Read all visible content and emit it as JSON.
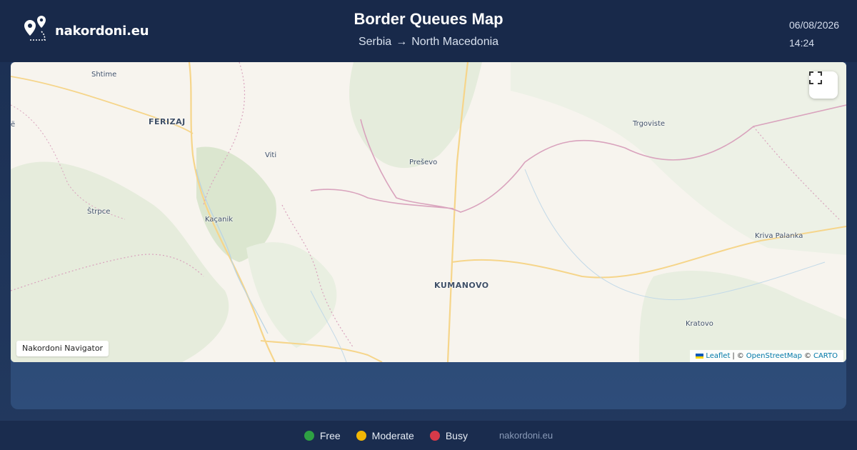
{
  "brand": {
    "name": "nakordoni.eu",
    "logo_icon": "map-pins-icon"
  },
  "header": {
    "title": "Border Queues Map",
    "route_from": "Serbia",
    "route_arrow": "→",
    "route_to": "North Macedonia",
    "date": "06/08/2026",
    "time": "14:24"
  },
  "map": {
    "places": {
      "shtime": "Shtime",
      "ferizaj": "FERIZAJ",
      "viti": "Viti",
      "presevo": "Preševo",
      "trgoviste": "Trgoviste",
      "strpce": "Štrpce",
      "kacanik": "Kaçanik",
      "kriva_palanka": "Kriva Palanka",
      "kumanovo": "KUMANOVO",
      "kratovo": "Kratovo",
      "edge_char": "ë"
    },
    "fullscreen_icon": "expand-icon",
    "navigator_label": "Nakordoni Navigator",
    "attribution": {
      "leaflet": "Leaflet",
      "separator": "|",
      "copy1": "©",
      "osm": "OpenStreetMap",
      "copy2": "©",
      "carto": "CARTO"
    }
  },
  "legend": [
    {
      "label": "Free",
      "color": "#2ea043"
    },
    {
      "label": "Moderate",
      "color": "#f2b705"
    },
    {
      "label": "Busy",
      "color": "#d73a49"
    }
  ],
  "footer": {
    "site": "nakordoni.eu"
  }
}
